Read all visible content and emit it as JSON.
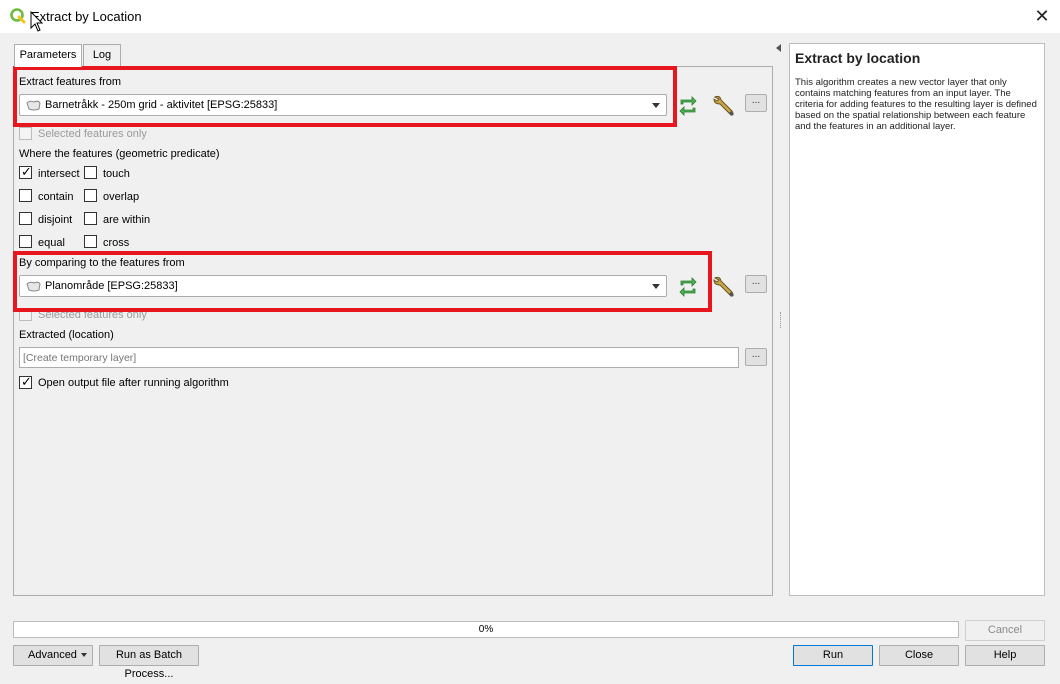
{
  "window": {
    "title": "Extract by Location",
    "close_glyph": "✕",
    "app_icon": "qgis-icon"
  },
  "tabs": [
    {
      "label": "Parameters",
      "active": true
    },
    {
      "label": "Log",
      "active": false
    }
  ],
  "params": {
    "input_label": "Extract features from",
    "input_value": "Barnetråkk - 250m grid - aktivitet [EPSG:25833]",
    "input_selected_only": "Selected features only",
    "predicate_label": "Where the features (geometric predicate)",
    "predicates": [
      {
        "label": "intersect",
        "checked": true
      },
      {
        "label": "touch",
        "checked": false
      },
      {
        "label": "contain",
        "checked": false
      },
      {
        "label": "overlap",
        "checked": false
      },
      {
        "label": "disjoint",
        "checked": false
      },
      {
        "label": "are within",
        "checked": false
      },
      {
        "label": "equal",
        "checked": false
      },
      {
        "label": "cross",
        "checked": false
      }
    ],
    "compare_label": "By comparing to the features from",
    "compare_value": "Planområde [EPSG:25833]",
    "compare_selected_only": "Selected features only",
    "output_label": "Extracted (location)",
    "output_placeholder": "[Create temporary layer]",
    "open_output_label": "Open output file after running algorithm",
    "open_output_checked": true,
    "browse_label": "...",
    "check_glyph": "✓"
  },
  "help": {
    "title": "Extract by location",
    "body": "This algorithm creates a new vector layer that only contains matching features from an input layer. The criteria for adding features to the resulting layer is defined based on the spatial relationship between each feature and the features in an additional layer."
  },
  "progress": {
    "text": "0%",
    "value": 0
  },
  "buttons": {
    "cancel": "Cancel",
    "advanced": "Advanced",
    "batch": "Run as Batch Process...",
    "run": "Run",
    "close": "Close",
    "help": "Help"
  },
  "colors": {
    "highlight": "#e8161e",
    "refresh_icon": "#4caf50"
  }
}
